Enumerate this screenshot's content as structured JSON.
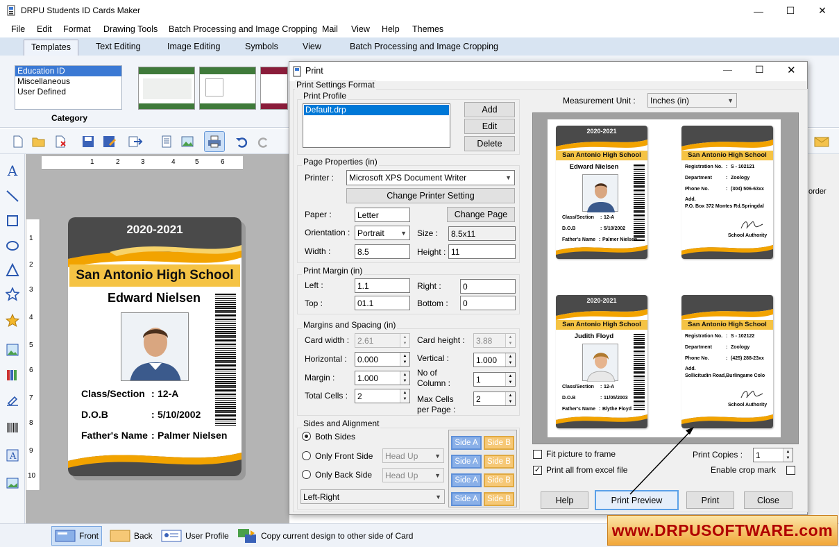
{
  "app": {
    "title": "DRPU Students ID Cards Maker",
    "menu": [
      "File",
      "Edit",
      "Format",
      "Drawing Tools",
      "Batch Processing and Image Cropping",
      "Mail",
      "View",
      "Help",
      "Themes"
    ],
    "ribbon_tabs": [
      "Templates",
      "Text Editing",
      "Image Editing",
      "Symbols",
      "View",
      "Batch Processing and Image Cropping"
    ],
    "category": {
      "label": "Category",
      "items": [
        "Education ID",
        "Miscellaneous",
        "User Defined"
      ],
      "selected": "Education ID"
    },
    "ruler_h": [
      "1",
      "2",
      "3",
      "4",
      "5",
      "6"
    ],
    "ruler_v": [
      "1",
      "2",
      "3",
      "4",
      "5",
      "6",
      "7",
      "8",
      "9",
      "10"
    ],
    "right_panel_text": "order",
    "bottom_tabs": {
      "front": "Front",
      "back": "Back",
      "user_profile": "User Profile",
      "copy": "Copy current design to other side of Card"
    },
    "colors": {
      "accent": "#3b79d4",
      "card_yellow": "#f5c344",
      "card_gray": "#4a4a4a",
      "card_orange": "#f2a300"
    }
  },
  "card": {
    "year": "2020-2021",
    "school": "San Antonio High School",
    "name": "Edward Nielsen",
    "fields": [
      {
        "label": "Class/Section",
        "sep": ":",
        "value": "12-A"
      },
      {
        "label": "D.O.B",
        "sep": ":",
        "value": "5/10/2002"
      },
      {
        "label": "Father's Name",
        "sep": ":",
        "value": "Palmer Nielsen"
      }
    ]
  },
  "dialog": {
    "title": "Print",
    "format_label": "Print Settings Format",
    "profile": {
      "label": "Print Profile",
      "items": [
        "Default.drp"
      ],
      "add": "Add",
      "edit": "Edit",
      "delete": "Delete"
    },
    "page": {
      "label": "Page Properties  (in)",
      "printer_label": "Printer :",
      "printer": "Microsoft XPS Document Writer",
      "change_printer": "Change Printer Setting",
      "paper_label": "Paper :",
      "paper": "Letter",
      "change_page": "Change Page",
      "orientation_label": "Orientation :",
      "orientation": "Portrait",
      "size_label": "Size :",
      "size": "8.5x11",
      "width_label": "Width :",
      "width": "8.5",
      "height_label": "Height :",
      "height": "11"
    },
    "margin": {
      "label": "Print Margin (in)",
      "left_label": "Left :",
      "left": "1.1",
      "right_label": "Right :",
      "right": "0",
      "top_label": "Top :",
      "top": "01.1",
      "bottom_label": "Bottom :",
      "bottom": "0"
    },
    "spacing": {
      "label": "Margins and Spacing  (in)",
      "card_width_label": "Card width :",
      "card_width": "2.61",
      "card_height_label": "Card height :",
      "card_height": "3.88",
      "horizontal_label": "Horizontal :",
      "horizontal": "0.000",
      "vertical_label": "Vertical :",
      "vertical": "1.000",
      "margin_label": "Margin :",
      "margin": "1.000",
      "columns_label_1": "No of",
      "columns_label_2": "Column :",
      "columns": "1",
      "total_label": "Total Cells :",
      "total": "2",
      "max_label_1": "Max Cells",
      "max_label_2": "per Page :",
      "max": "2"
    },
    "sides": {
      "label": "Sides and Alignment",
      "both": "Both Sides",
      "front": "Only Front Side",
      "back": "Only Back Side",
      "head_up": "Head Up",
      "alignment": "Left-Right",
      "side_a": "Side A",
      "side_b": "Side B"
    },
    "measurement_label": "Measurement Unit :",
    "measurement": "Inches (in)",
    "fit_label": "Fit picture to frame",
    "fit_checked": false,
    "excel_label": "Print all from excel file",
    "excel_checked": true,
    "copies_label": "Print Copies :",
    "copies": "1",
    "crop_label": "Enable crop mark",
    "crop_checked": false,
    "buttons": {
      "help": "Help",
      "preview": "Print Preview",
      "print": "Print",
      "close": "Close"
    }
  },
  "preview_cards": [
    {
      "year": "2020-2021",
      "school": "San Antonio High School",
      "name": "Edward Nielsen",
      "class_label": "Class/Section",
      "class": "12-A",
      "dob_label": "D.O.B",
      "dob": "5/10/2002",
      "father_label": "Father's Name",
      "father": "Palmer Nielsen"
    },
    {
      "school": "San Antonio High School",
      "reg_label": "Registration No.",
      "reg": "S - 102121",
      "dept_label": "Department",
      "dept": "Zoology",
      "phone_label": "Phone No.",
      "phone": "(304) 506-63xx",
      "add_label": "Add.",
      "address": "P.O. Box 372 Montes Rd.Springdal",
      "authority": "School Authority"
    },
    {
      "year": "2020-2021",
      "school": "San Antonio High School",
      "name": "Judith Floyd",
      "class_label": "Class/Section",
      "class": "12-A",
      "dob_label": "D.O.B",
      "dob": "11/05/2003",
      "father_label": "Father's Name",
      "father": "Blythe Floyd"
    },
    {
      "school": "San Antonio High School",
      "reg_label": "Registration No.",
      "reg": "S - 102122",
      "dept_label": "Department",
      "dept": "Zoology",
      "phone_label": "Phone No.",
      "phone": "(425) 288-23xx",
      "add_label": "Add.",
      "address": "Sollicitudin Road,Burlingame Colo",
      "authority": "School Authority"
    }
  ],
  "watermark": "www.DRPUSOFTWARE.com"
}
